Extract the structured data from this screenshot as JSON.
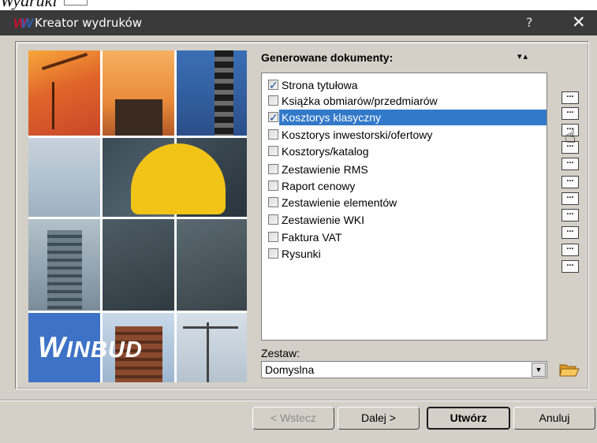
{
  "caption": {
    "text": "Wydruki"
  },
  "window": {
    "title": "Kreator wydruków",
    "help_label": "?",
    "close_label": "✕"
  },
  "logo": {
    "text_big": "W",
    "text_rest": "INBUD"
  },
  "documents": {
    "heading": "Generowane dokumenty:",
    "sort_arrows": "▾▴",
    "items": [
      {
        "label": "Strona tytułowa",
        "checked": true,
        "selected": false
      },
      {
        "label": "Książka obmiarów/przedmiarów",
        "checked": false,
        "selected": false
      },
      {
        "label": "Kosztorys klasyczny",
        "checked": true,
        "selected": true
      },
      {
        "label": "Kosztorys inwestorski/ofertowy",
        "checked": false,
        "selected": false
      },
      {
        "label": "Kosztorys/katalog",
        "checked": false,
        "selected": false
      },
      {
        "label": "Zestawienie RMS",
        "checked": false,
        "selected": false
      },
      {
        "label": "Raport cenowy",
        "checked": false,
        "selected": false
      },
      {
        "label": "Zestawienie elementów",
        "checked": false,
        "selected": false
      },
      {
        "label": "Zestawienie WKI",
        "checked": false,
        "selected": false
      },
      {
        "label": "Faktura VAT",
        "checked": false,
        "selected": false
      },
      {
        "label": "Rysunki",
        "checked": false,
        "selected": false
      }
    ],
    "options_button_label": "..."
  },
  "zestaw": {
    "label": "Zestaw:",
    "value": "Domyslna"
  },
  "buttons": {
    "back": "< Wstecz",
    "next": "Dalej >",
    "create": "Utwórz",
    "cancel": "Anuluj"
  }
}
